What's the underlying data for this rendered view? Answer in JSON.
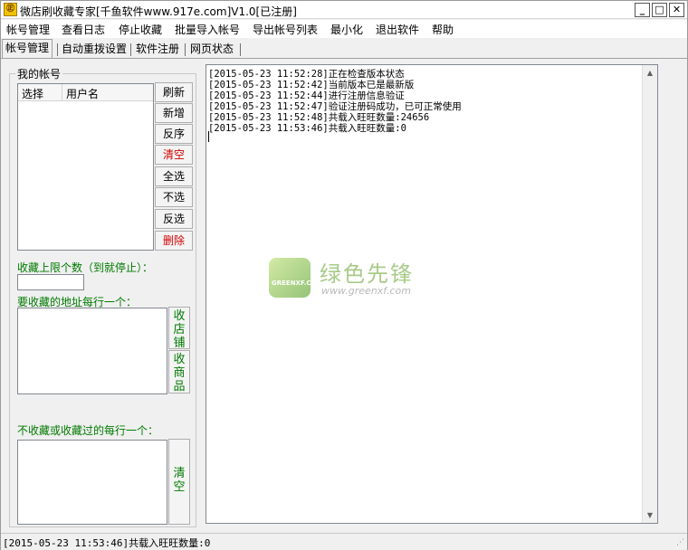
{
  "window": {
    "icon_char": "㊣",
    "title": "微店刷收藏专家[千鱼软件www.917e.com]V1.0[已注册]",
    "minimize": "_",
    "maximize": "□",
    "close": "✕"
  },
  "menu": [
    "帐号管理",
    "查看日志",
    "停止收藏",
    "批量导入帐号",
    "导出帐号列表",
    "最小化",
    "退出软件",
    "帮助"
  ],
  "tabs": [
    {
      "label": "帐号管理",
      "active": true
    },
    {
      "label": "自动重拨设置",
      "active": false
    },
    {
      "label": "软件注册",
      "active": false
    },
    {
      "label": "网页状态",
      "active": false
    }
  ],
  "accounts": {
    "group_label": "我的帐号",
    "columns": [
      "选择",
      "用户名"
    ],
    "buttons": {
      "refresh": "刷新",
      "add": "新增",
      "reverse_order": "反序",
      "clear": "清空",
      "select_all": "全选",
      "deselect": "不选",
      "invert": "反选",
      "delete": "删除"
    }
  },
  "limit": {
    "label": "收藏上限个数（到就停止）：",
    "value": ""
  },
  "urls": {
    "label": "要收藏的地址每行一个：",
    "value": "",
    "collect_shop": "收店铺",
    "collect_goods": "收商品"
  },
  "exclude": {
    "label": "不收藏或收藏过的每行一个：",
    "value": "",
    "clear": "清空"
  },
  "log": [
    "[2015-05-23 11:52:28]正在检查版本状态",
    "[2015-05-23 11:52:42]当前版本已是最新版",
    "[2015-05-23 11:52:44]进行注册信息验证",
    "[2015-05-23 11:52:47]验证注册码成功，已可正常使用",
    "[2015-05-23 11:52:48]共载入旺旺数量:24656",
    "[2015-05-23 11:53:46]共载入旺旺数量:0"
  ],
  "status": "[2015-05-23 11:53:46]共载入旺旺数量:0",
  "watermark": {
    "logo_text": "GREENXF.COM",
    "title": "绿色先锋",
    "url": "www.greenxf.com"
  }
}
